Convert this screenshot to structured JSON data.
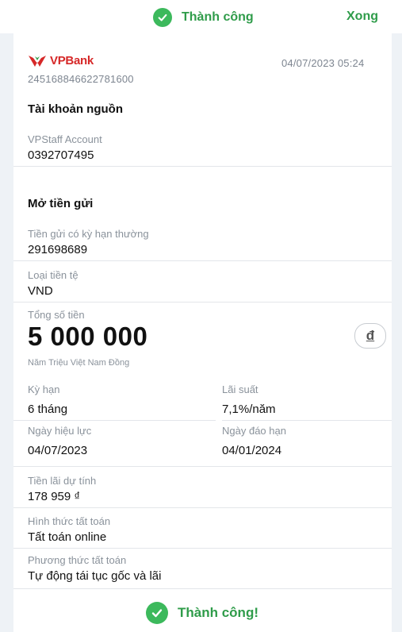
{
  "header": {
    "status_text": "Thành công",
    "done_label": "Xong"
  },
  "receipt": {
    "brand": "VPBank",
    "transaction_id": "245168846622781600",
    "datetime": "04/07/2023 05:24",
    "source_section": {
      "title": "Tài khoản nguồn",
      "account_name": "VPStaff Account",
      "account_number": "0392707495"
    },
    "deposit_section": {
      "title": "Mở tiền gửi",
      "product_label": "Tiền gửi có kỳ hạn thường",
      "product_value": "291698689",
      "currency_label": "Loại tiền tệ",
      "currency_value": "VND",
      "total_label": "Tổng số tiền",
      "total_value": "5 000 000",
      "total_words": "Năm Triệu Việt Nam Đồng",
      "currency_symbol": "đ",
      "term_label": "Kỳ hạn",
      "term_value": "6 tháng",
      "rate_label": "Lãi suất",
      "rate_value": "7,1%/năm",
      "effective_label": "Ngày hiệu lực",
      "effective_value": "04/07/2023",
      "maturity_label": "Ngày đáo hạn",
      "maturity_value": "04/01/2024",
      "interest_label": "Tiền lãi dự tính",
      "interest_value": "178 959 ₫",
      "settlement_form_label": "Hình thức tất toán",
      "settlement_form_value": "Tất toán online",
      "settlement_method_label": "Phương thức tất toán",
      "settlement_method_value": "Tự động tái tục gốc và lãi"
    },
    "footer_status": "Thành công!"
  },
  "colors": {
    "success_green": "#3cb95c",
    "success_text": "#2f9c4a",
    "brand_red": "#d62828",
    "side_bg": "#eef2f6"
  }
}
